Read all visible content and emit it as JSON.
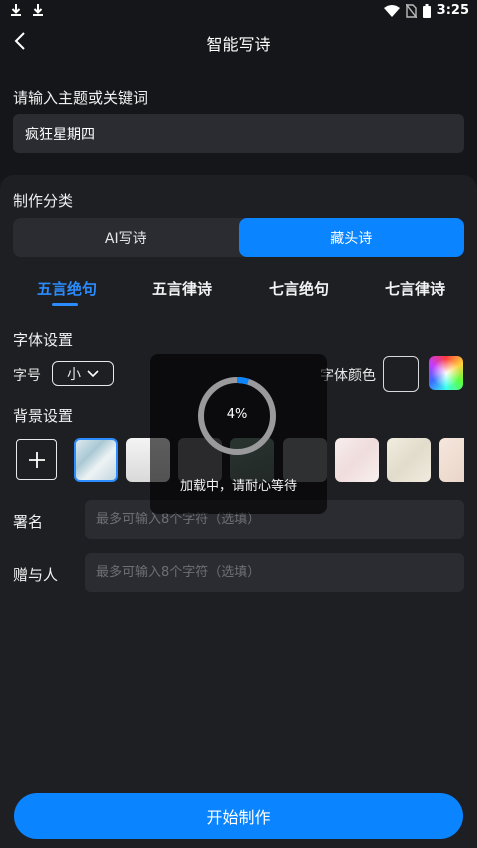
{
  "status_bar": {
    "time": "3:25"
  },
  "nav": {
    "title": "智能写诗"
  },
  "theme": {
    "label": "请输入主题或关键词",
    "value": "疯狂星期四"
  },
  "category": {
    "label": "制作分类",
    "options": [
      "AI写诗",
      "藏头诗"
    ],
    "selected": "藏头诗"
  },
  "poem_tabs": {
    "items": [
      "五言绝句",
      "五言律诗",
      "七言绝句",
      "七言律诗"
    ],
    "selected": "五言绝句"
  },
  "font": {
    "label": "字体设置",
    "size_label": "字号",
    "size_value": "小",
    "color_label": "字体颜色"
  },
  "background": {
    "label": "背景设置"
  },
  "signature": {
    "label": "署名",
    "placeholder": "最多可输入8个字符（选填）"
  },
  "recipient": {
    "label": "赠与人",
    "placeholder": "最多可输入8个字符（选填）"
  },
  "start_button": {
    "label": "开始制作"
  },
  "loading": {
    "percent": "4%",
    "progress": 0.04,
    "text": "加载中，请耐心等待"
  },
  "colors": {
    "accent": "#0a84ff",
    "background": "#151619",
    "panel": "#1e1f23",
    "input": "#2b2c31"
  }
}
